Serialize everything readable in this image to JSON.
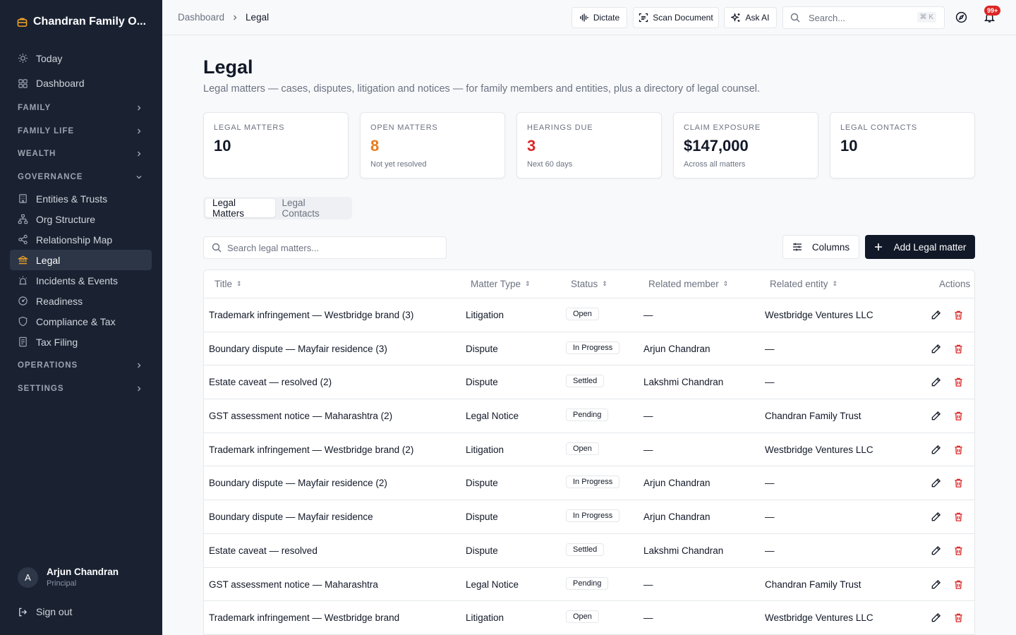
{
  "app": {
    "brand": "Chandran Family O..."
  },
  "sidebar": {
    "items_top": [
      {
        "label": "Today",
        "icon": "sun-icon"
      },
      {
        "label": "Dashboard",
        "icon": "grid-icon"
      }
    ],
    "sections": [
      "FAMILY",
      "FAMILY LIFE",
      "WEALTH",
      "GOVERNANCE"
    ],
    "governance_items": [
      {
        "label": "Entities & Trusts",
        "icon": "building-icon"
      },
      {
        "label": "Org Structure",
        "icon": "org-icon"
      },
      {
        "label": "Relationship Map",
        "icon": "share-icon"
      },
      {
        "label": "Legal",
        "icon": "bank-icon"
      },
      {
        "label": "Incidents & Events",
        "icon": "siren-icon"
      },
      {
        "label": "Readiness",
        "icon": "gauge-icon"
      },
      {
        "label": "Compliance & Tax",
        "icon": "shield-icon"
      },
      {
        "label": "Tax Filing",
        "icon": "receipt-icon"
      }
    ],
    "sections_bottom": [
      "OPERATIONS",
      "SETTINGS"
    ],
    "user": {
      "initial": "A",
      "name": "Arjun Chandran",
      "role": "Principal"
    },
    "signout": "Sign out"
  },
  "topbar": {
    "breadcrumb": [
      "Dashboard",
      "Legal"
    ],
    "dictate": "Dictate",
    "scan": "Scan Document",
    "ask_ai": "Ask AI",
    "search_placeholder": "Search...",
    "shortcut": "⌘ K",
    "notifications": "99+"
  },
  "page": {
    "title": "Legal",
    "subtitle": "Legal matters — cases, disputes, litigation and notices — for family members and entities, plus a directory of legal counsel."
  },
  "stats": [
    {
      "label": "LEGAL MATTERS",
      "value": "10",
      "sub": "",
      "color": "#111827"
    },
    {
      "label": "OPEN MATTERS",
      "value": "8",
      "sub": "Not yet resolved",
      "color": "#ea7a1a"
    },
    {
      "label": "HEARINGS DUE",
      "value": "3",
      "sub": "Next 60 days",
      "color": "#dc2626"
    },
    {
      "label": "CLAIM EXPOSURE",
      "value": "$147,000",
      "sub": "Across all matters",
      "color": "#111827"
    },
    {
      "label": "LEGAL CONTACTS",
      "value": "10",
      "sub": "",
      "color": "#111827"
    }
  ],
  "tabs": {
    "matters": "Legal Matters",
    "contacts": "Legal Contacts"
  },
  "toolbar": {
    "search_placeholder": "Search legal matters...",
    "columns": "Columns",
    "add": "Add Legal matter"
  },
  "table": {
    "headers": {
      "title": "Title",
      "type": "Matter Type",
      "status": "Status",
      "member": "Related member",
      "entity": "Related entity",
      "actions": "Actions"
    },
    "rows": [
      {
        "title": "Trademark infringement — Westbridge brand (3)",
        "type": "Litigation",
        "status": "Open",
        "member": "—",
        "entity": "Westbridge Ventures LLC"
      },
      {
        "title": "Boundary dispute — Mayfair residence (3)",
        "type": "Dispute",
        "status": "In Progress",
        "member": "Arjun Chandran",
        "entity": "—"
      },
      {
        "title": "Estate caveat — resolved (2)",
        "type": "Dispute",
        "status": "Settled",
        "member": "Lakshmi Chandran",
        "entity": "—"
      },
      {
        "title": "GST assessment notice — Maharashtra (2)",
        "type": "Legal Notice",
        "status": "Pending",
        "member": "—",
        "entity": "Chandran Family Trust"
      },
      {
        "title": "Trademark infringement — Westbridge brand (2)",
        "type": "Litigation",
        "status": "Open",
        "member": "—",
        "entity": "Westbridge Ventures LLC"
      },
      {
        "title": "Boundary dispute — Mayfair residence (2)",
        "type": "Dispute",
        "status": "In Progress",
        "member": "Arjun Chandran",
        "entity": "—"
      },
      {
        "title": "Boundary dispute — Mayfair residence",
        "type": "Dispute",
        "status": "In Progress",
        "member": "Arjun Chandran",
        "entity": "—"
      },
      {
        "title": "Estate caveat — resolved",
        "type": "Dispute",
        "status": "Settled",
        "member": "Lakshmi Chandran",
        "entity": "—"
      },
      {
        "title": "GST assessment notice — Maharashtra",
        "type": "Legal Notice",
        "status": "Pending",
        "member": "—",
        "entity": "Chandran Family Trust"
      },
      {
        "title": "Trademark infringement — Westbridge brand",
        "type": "Litigation",
        "status": "Open",
        "member": "—",
        "entity": "Westbridge Ventures LLC"
      }
    ]
  }
}
